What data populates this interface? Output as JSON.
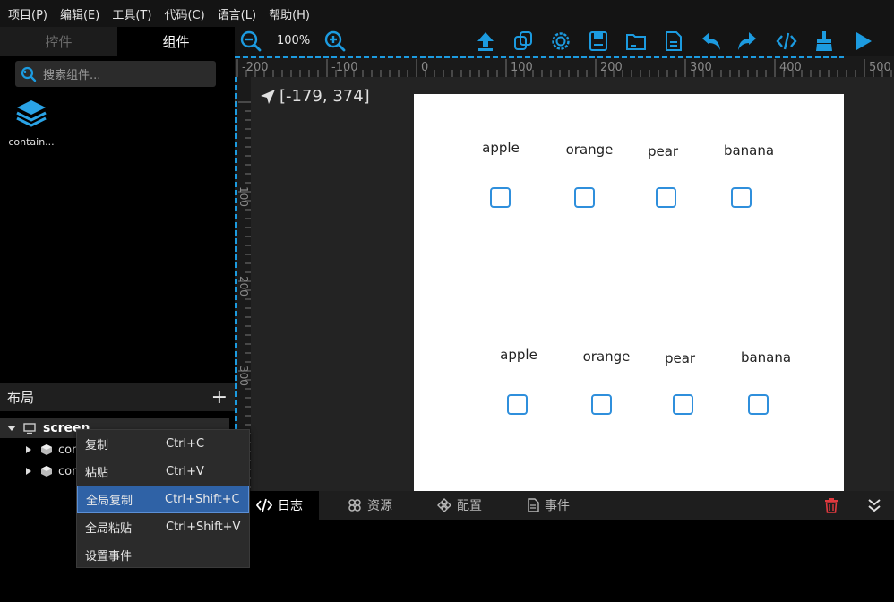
{
  "menubar": {
    "items": [
      "项目(P)",
      "编辑(E)",
      "工具(T)",
      "代码(C)",
      "语言(L)",
      "帮助(H)"
    ]
  },
  "left_panel": {
    "tabs": [
      {
        "label": "控件",
        "active": false
      },
      {
        "label": "组件",
        "active": true
      }
    ],
    "search_placeholder": "搜索组件...",
    "widgets": [
      {
        "label": "contain...",
        "icon": "layers-icon"
      }
    ],
    "layout_title": "布局",
    "tree": {
      "root": "screen",
      "children": [
        "con",
        "con"
      ]
    }
  },
  "context_menu": {
    "items": [
      {
        "label": "复制",
        "shortcut": "Ctrl+C",
        "selected": false
      },
      {
        "label": "粘贴",
        "shortcut": "Ctrl+V",
        "selected": false
      },
      {
        "label": "全局复制",
        "shortcut": "Ctrl+Shift+C",
        "selected": true
      },
      {
        "label": "全局粘贴",
        "shortcut": "Ctrl+Shift+V",
        "selected": false
      },
      {
        "label": "设置事件",
        "shortcut": "",
        "selected": false
      }
    ]
  },
  "toolbar": {
    "zoom": "100%",
    "icons": [
      "zoom-out-icon",
      "zoom-in-icon",
      "upload-icon",
      "copy-icon",
      "settings-icon",
      "save-icon",
      "folder-icon",
      "file-icon",
      "undo-icon",
      "redo-icon",
      "code-icon",
      "clean-icon",
      "play-icon"
    ],
    "accent": "#1c9be0"
  },
  "ruler": {
    "h_labels": [
      "-200",
      "-100",
      "0",
      "100",
      "200",
      "300",
      "400",
      "500"
    ],
    "v_labels": [
      "0",
      "100",
      "200",
      "300"
    ]
  },
  "canvas": {
    "coords": "[-179, 374]",
    "rows": [
      {
        "labels": [
          "apple",
          "orange",
          "pear",
          "banana"
        ]
      },
      {
        "labels": [
          "apple",
          "orange",
          "pear",
          "banana"
        ]
      }
    ],
    "checkbox_color": "#2f8fdc"
  },
  "bottom_panel": {
    "tabs": [
      {
        "label": "日志",
        "icon": "code-icon",
        "active": true
      },
      {
        "label": "资源",
        "icon": "resource-icon",
        "active": false
      },
      {
        "label": "配置",
        "icon": "config-icon",
        "active": false
      },
      {
        "label": "事件",
        "icon": "event-icon",
        "active": false
      }
    ],
    "delete_color": "#e0393e"
  }
}
